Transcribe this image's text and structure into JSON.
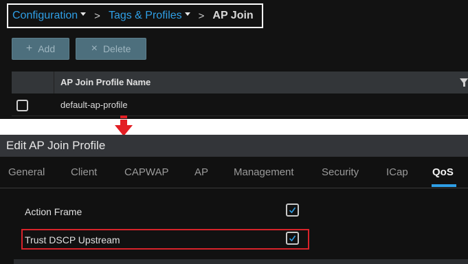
{
  "breadcrumb": {
    "items": [
      {
        "label": "Configuration"
      },
      {
        "label": "Tags & Profiles"
      }
    ],
    "separator": ">",
    "current": "AP Join"
  },
  "toolbar": {
    "add_label": "Add",
    "delete_label": "Delete",
    "add_icon": "+",
    "delete_icon": "×"
  },
  "table": {
    "column_header": "AP Join Profile Name",
    "rows": [
      {
        "name": "default-ap-profile",
        "checked": false
      }
    ]
  },
  "edit_panel": {
    "title": "Edit AP Join Profile",
    "tabs": [
      {
        "label": "General"
      },
      {
        "label": "Client"
      },
      {
        "label": "CAPWAP"
      },
      {
        "label": "AP"
      },
      {
        "label": "Management"
      },
      {
        "label": "Security"
      },
      {
        "label": "ICap"
      },
      {
        "label": "QoS",
        "active": true
      }
    ],
    "fields": [
      {
        "label": "Action Frame",
        "checked": true
      },
      {
        "label": "Trust DSCP Upstream",
        "checked": true
      }
    ]
  },
  "colors": {
    "link": "#2f9fe6",
    "button_bg": "#4d6f7d",
    "highlight_border": "#d9232a",
    "arrow": "#e31e24"
  }
}
